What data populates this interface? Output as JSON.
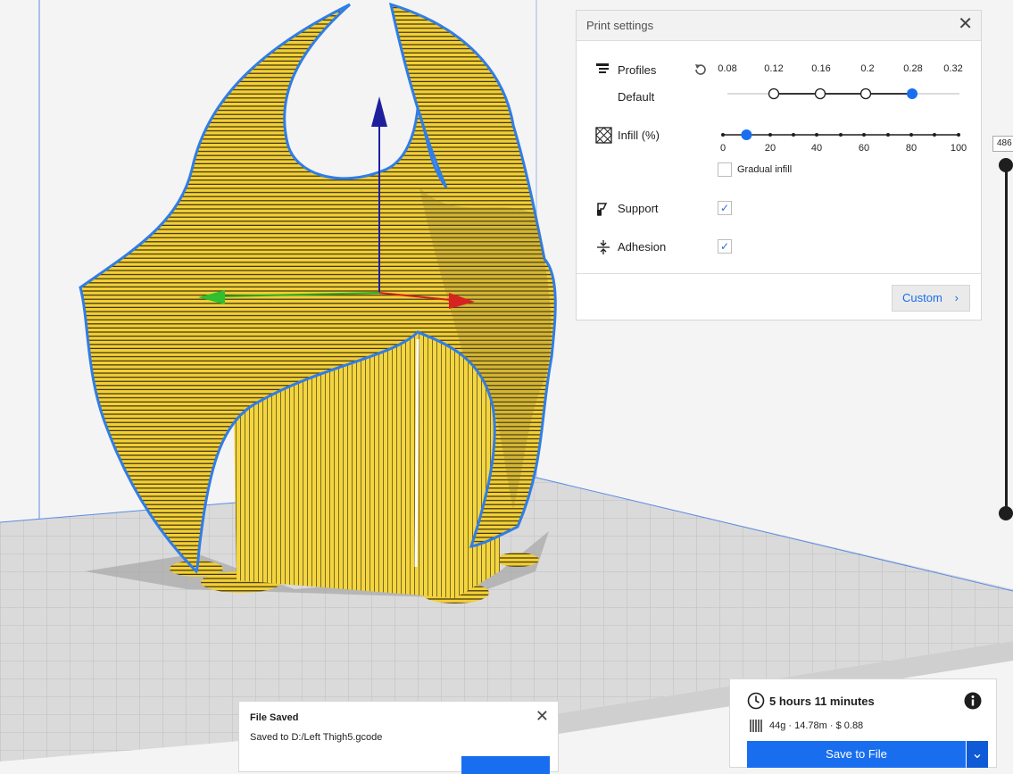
{
  "print_settings": {
    "title": "Print settings",
    "profiles": {
      "label": "Profiles",
      "current": "Default",
      "ticks": [
        "0.08",
        "0.12",
        "0.16",
        "0.2",
        "0.28",
        "0.32"
      ],
      "selected": "0.28"
    },
    "infill": {
      "label": "Infill (%)",
      "ticks": [
        "0",
        "20",
        "40",
        "60",
        "80",
        "100"
      ],
      "value_percent": 10,
      "gradual_label": "Gradual infill",
      "gradual_checked": false
    },
    "support": {
      "label": "Support",
      "checked": true
    },
    "adhesion": {
      "label": "Adhesion",
      "checked": true
    },
    "custom_label": "Custom"
  },
  "layer_slider": {
    "value": "486"
  },
  "toast": {
    "title": "File Saved",
    "message": "Saved to D:/Left Thigh5.gcode"
  },
  "job": {
    "time": "5 hours 11 minutes",
    "meta": "44g · 14.78m · $ 0.88",
    "save_label": "Save to File"
  },
  "colors": {
    "accent": "#196ef0",
    "model_fill": "#f5d53b",
    "model_outline": "#2f7de8",
    "build_plate": "#d9d9d9"
  }
}
